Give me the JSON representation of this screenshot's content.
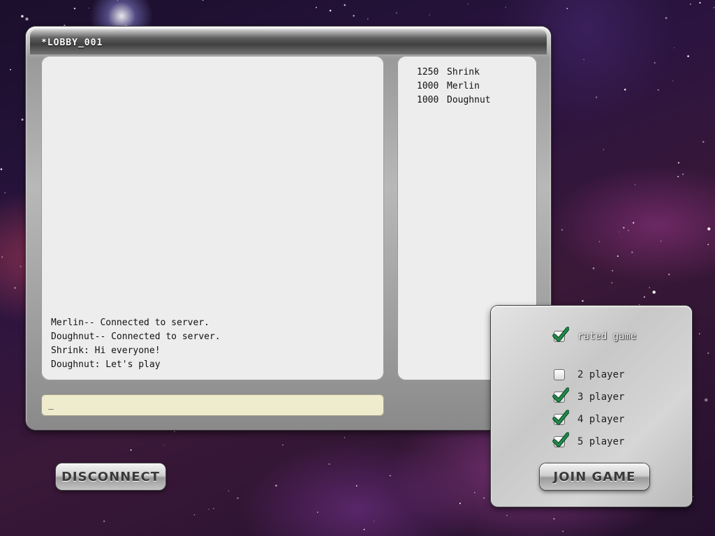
{
  "lobby": {
    "title": "*LOBBY_001",
    "chat_messages": [
      "Merlin-- Connected to server.",
      "Doughnut-- Connected to server.",
      "Shrink: Hi everyone!",
      "Doughnut: Let's play"
    ],
    "chat_input_value": "_",
    "players": [
      {
        "score": "1250",
        "name": "Shrink"
      },
      {
        "score": "1000",
        "name": "Merlin"
      },
      {
        "score": "1000",
        "name": "Doughnut"
      }
    ]
  },
  "buttons": {
    "disconnect": "DISCONNECT",
    "join_game": "JOIN GAME"
  },
  "options": {
    "rated_game": {
      "label": "rated game",
      "checked": true
    },
    "player_counts": [
      {
        "label": "2 player",
        "checked": false
      },
      {
        "label": "3 player",
        "checked": true
      },
      {
        "label": "4 player",
        "checked": true
      },
      {
        "label": "5 player",
        "checked": true
      }
    ]
  },
  "colors": {
    "check_green": "#1f8a4a",
    "input_bg": "#eeeccd",
    "panel_bg": "#ededed"
  }
}
